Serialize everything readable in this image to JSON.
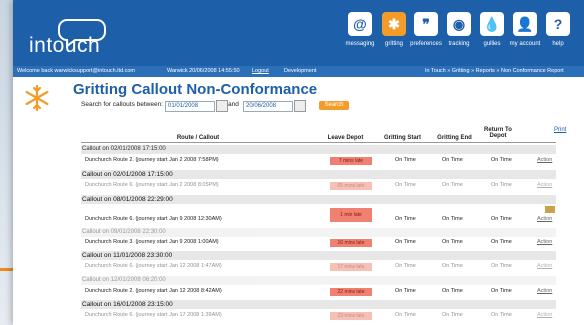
{
  "app": {
    "logo_text": "intouch"
  },
  "nav": [
    {
      "label": "messaging",
      "glyph": "@"
    },
    {
      "label": "gritting",
      "glyph": "✱"
    },
    {
      "label": "preferences",
      "glyph": "❞"
    },
    {
      "label": "tracking",
      "glyph": "◉"
    },
    {
      "label": "gullies",
      "glyph": "💧"
    },
    {
      "label": "my account",
      "glyph": "👤"
    },
    {
      "label": "help",
      "glyph": "?"
    }
  ],
  "topbar": {
    "welcome": "Welcome back warwicksupport@intouch.ltd.com",
    "org": "Warwick 20/06/2008 14:55:50",
    "logout": "Logout",
    "development": "Development",
    "breadcrumb": "In Touch » Gritting » Reports » Non Conformance Report"
  },
  "page": {
    "title": "Gritting Callout Non-Conformance",
    "search_label": "Search for callouts between:",
    "date_from": "01/01/2008",
    "and": "and",
    "date_to": "20/06/2008",
    "search_button": "Search",
    "print": "Print"
  },
  "table": {
    "headers": [
      "Route / Callout",
      "Leave Depot",
      "Gritting Start",
      "Gritting End",
      "Return To Depot"
    ],
    "groups": [
      {
        "callout": "Callout on 02/01/2008 17:15:00",
        "rows": []
      },
      {
        "callout": "",
        "rows": [
          {
            "route": "Dunchurch Route 2. (journey start Jan 2 2008 7:58PM)",
            "leave": "7 mins late",
            "start": "On Time",
            "end": "On Time",
            "return": "On Time",
            "action": "Action"
          }
        ]
      },
      {
        "callout": "Callout on 02/01/2008 17:15:00",
        "rows": [
          {
            "route": "Dunchurch Route 6. (journey start Jan 2 2008 8:05PM)",
            "leave": "65 mins late",
            "start": "On Time",
            "end": "On Time",
            "return": "On Time",
            "action": "Action"
          }
        ]
      },
      {
        "callout": "Callout on 08/01/2008 22:29:00",
        "rows": [
          {
            "route": "Dunchurch Route 6. (journey start Jan 9 2008 12:30AM)",
            "leave": "1 min late",
            "start": "On Time",
            "end": "On Time",
            "return": "On Time",
            "action": "Action"
          }
        ]
      },
      {
        "callout": "Callout on 09/01/2008 22:30:00",
        "rows": [
          {
            "route": "Dunchurch Route 3. (journey start Jan 9 2008 1:00AM)",
            "leave": "16 mins late",
            "start": "On Time",
            "end": "On Time",
            "return": "On Time",
            "action": "Action"
          }
        ]
      },
      {
        "callout": "Callout on 11/01/2008 23:30:00",
        "rows": [
          {
            "route": "Dunchurch Route 6. (journey start Jan 12 2008 1:47AM)",
            "leave": "17 mins late",
            "start": "On Time",
            "end": "On Time",
            "return": "On Time",
            "action": "Action"
          }
        ]
      },
      {
        "callout": "Callout on 12/01/2008 06:20:00",
        "rows": [
          {
            "route": "Dunchurch Route 2. (journey start Jan 12 2008 8:42AM)",
            "leave": "22 mins late",
            "start": "On Time",
            "end": "On Time",
            "return": "On Time",
            "action": "Action"
          }
        ]
      },
      {
        "callout": "Callout on 16/01/2008 23:15:00",
        "rows": [
          {
            "route": "Dunchurch Route 6. (journey start Jan 17 2008 1:39AM)",
            "leave": "23 mins late",
            "start": "On Time",
            "end": "On Time",
            "return": "On Time",
            "action": "Action"
          }
        ]
      }
    ]
  },
  "colors": {
    "header_blue": "#1d5fa8",
    "accent_orange": "#f39c2a",
    "late_badge": "#f08070"
  }
}
